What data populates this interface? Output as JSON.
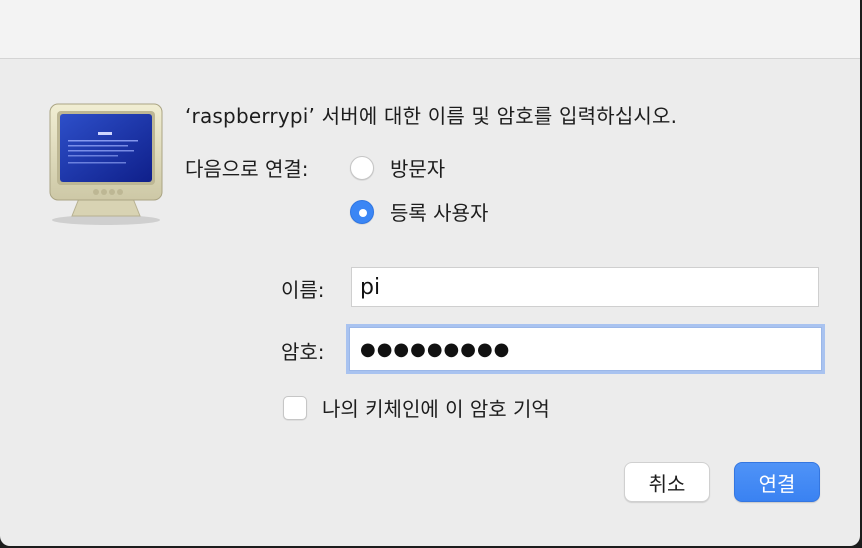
{
  "dialog": {
    "prompt": "‘raspberrypi’ 서버에 대한 이름 및 암호를 입력하십시오.",
    "connect_as_label": "다음으로 연결:",
    "options": {
      "guest": "방문자",
      "registered": "등록 사용자",
      "selected": "registered"
    },
    "name_label": "이름:",
    "name_value": "pi",
    "password_label": "암호:",
    "password_value": "●●●●●●●●●",
    "remember_label": "나의 키체인에 이 암호 기억",
    "remember_checked": false,
    "cancel_label": "취소",
    "connect_label": "연결"
  },
  "colors": {
    "accent": "#3b86f5",
    "background": "#ececec",
    "focus_ring": "#a9c3f0"
  },
  "icons": {
    "server": "monitor-icon"
  }
}
